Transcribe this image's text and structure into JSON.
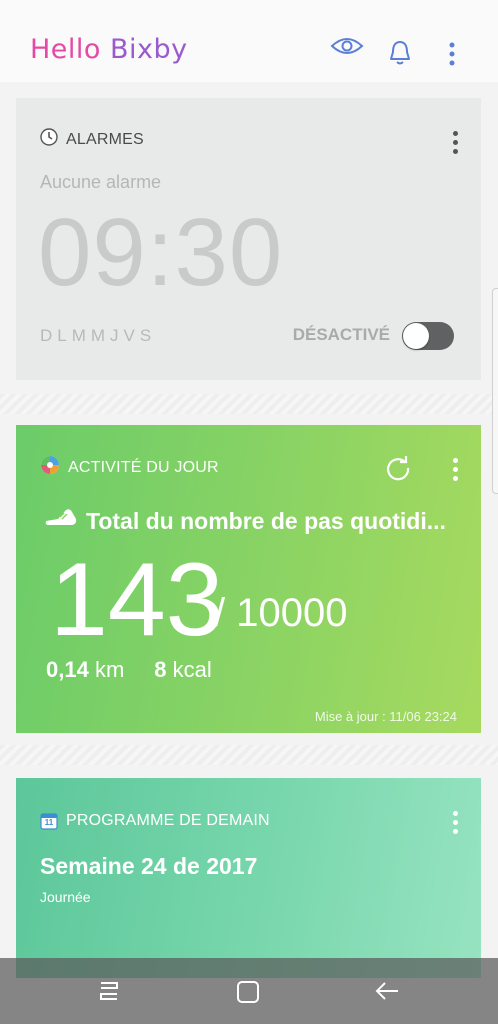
{
  "header": {
    "title_part1": "Hello ",
    "title_part2": "Bixby"
  },
  "alarm": {
    "title": "ALARMES",
    "subtitle": "Aucune alarme",
    "time": "09:30",
    "days": "DLMMJVS",
    "status": "DÉSACTIVÉ",
    "enabled": false
  },
  "activity": {
    "title": "ACTIVITÉ DU JOUR",
    "steps_label": "Total du nombre de pas quotidi...",
    "steps": "143",
    "goal": "/ 10000",
    "distance": "0,14",
    "distance_unit": "km",
    "calories": "8",
    "calories_unit": "kcal",
    "updated": "Mise à jour : 11/06 23:24"
  },
  "schedule": {
    "title": "PROGRAMME DE DEMAIN",
    "calendar_day": "11",
    "week": "Semaine 24 de 2017",
    "subtitle": "Journée"
  },
  "colors": {
    "accent_pink": "#e44aa5",
    "accent_purple": "#9b59d0",
    "icon_blue": "#5b7fd6",
    "activity_green": "#8ed463",
    "schedule_teal": "#79d7ad"
  },
  "icons": {
    "header": [
      "eye-icon",
      "bell-icon",
      "more-vert-icon"
    ],
    "alarm": "clock-icon",
    "activity": [
      "activity-app-icon",
      "refresh-icon",
      "shoe-icon"
    ],
    "schedule": "calendar-icon",
    "nav": [
      "recent-apps-icon",
      "home-icon",
      "back-icon"
    ]
  }
}
